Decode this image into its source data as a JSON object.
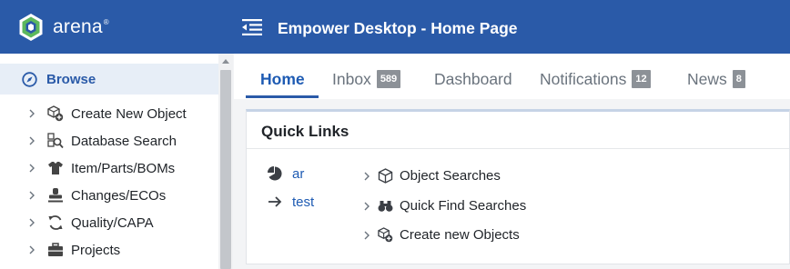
{
  "header": {
    "brand_name": "arena",
    "brand_mark": "®",
    "page_title": "Empower Desktop - Home Page",
    "menu_icon": "menu-collapse-icon",
    "background": "#2a5aa8"
  },
  "sidebar": {
    "browse": {
      "label": "Browse",
      "icon": "compass-icon"
    },
    "items": [
      {
        "label": "Create New Object",
        "icon": "box-plus-icon"
      },
      {
        "label": "Database Search",
        "icon": "database-search-icon"
      },
      {
        "label": "Item/Parts/BOMs",
        "icon": "shirt-icon"
      },
      {
        "label": "Changes/ECOs",
        "icon": "stamp-icon"
      },
      {
        "label": "Quality/CAPA",
        "icon": "refresh-icon"
      },
      {
        "label": "Projects",
        "icon": "briefcase-icon"
      }
    ]
  },
  "tabs": [
    {
      "label": "Home",
      "active": true
    },
    {
      "label": "Inbox",
      "badge": "589"
    },
    {
      "label": "Dashboard"
    },
    {
      "label": "Notifications",
      "badge": "12"
    },
    {
      "label": "News",
      "badge": "8"
    }
  ],
  "quick_links": {
    "title": "Quick Links",
    "links": [
      {
        "label": "ar",
        "icon": "pie-chart-icon"
      },
      {
        "label": "test",
        "icon": "arrow-right-icon"
      }
    ],
    "sections": [
      {
        "label": "Object Searches",
        "icon": "cube-icon"
      },
      {
        "label": "Quick Find Searches",
        "icon": "binoculars-icon"
      },
      {
        "label": "Create new Objects",
        "icon": "box-plus-icon"
      }
    ]
  },
  "colors": {
    "accent": "#2a5aa8",
    "link": "#1e5bb3",
    "badge": "#8c9197"
  }
}
